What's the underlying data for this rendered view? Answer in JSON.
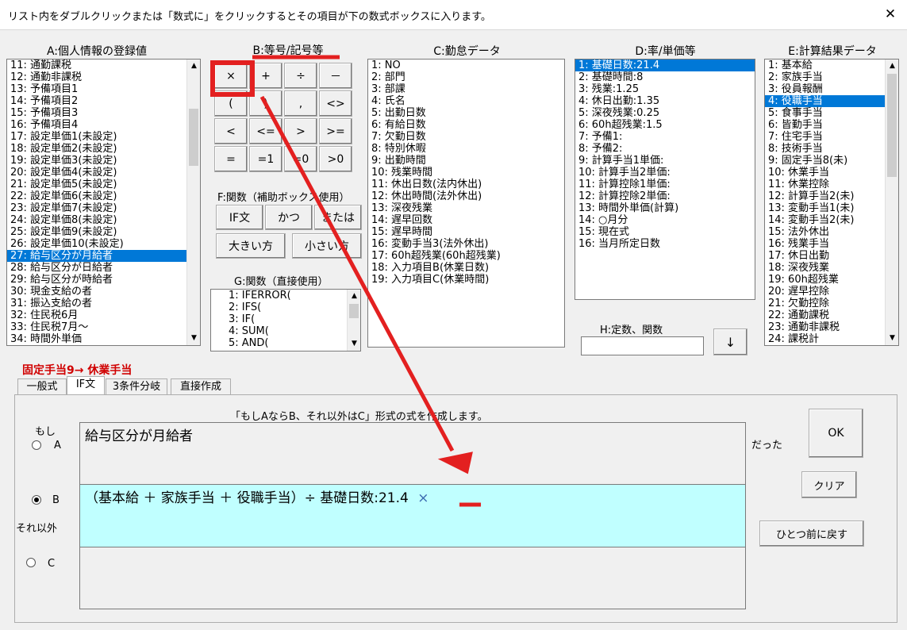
{
  "window": {
    "title": "リスト内をダブルクリックまたは「数式に」をクリックするとその項目が下の数式ボックスに入ります。",
    "close": "✕"
  },
  "headers": {
    "a": "A:個人情報の登録値",
    "b": "B:等号/記号等",
    "c": "C:勤怠データ",
    "d": "D:率/単価等",
    "e": "E:計算結果データ",
    "f": "F:関数（補助ボックス使用）",
    "g": "G:関数（直接使用）",
    "h": "H:定数、関数"
  },
  "list_a": [
    "11: 通勤課税",
    "12: 通勤非課税",
    "13: 予備項目1",
    "14: 予備項目2",
    "15: 予備項目3",
    "16: 予備項目4",
    "17: 設定単価1(未設定)",
    "18: 設定単価2(未設定)",
    "19: 設定単価3(未設定)",
    "20: 設定単価4(未設定)",
    "21: 設定単価5(未設定)",
    "22: 設定単価6(未設定)",
    "23: 設定単価7(未設定)",
    "24: 設定単価8(未設定)",
    "25: 設定単価9(未設定)",
    "26: 設定単価10(未設定)",
    "27: 給与区分が月給者",
    "28: 給与区分が日給者",
    "29: 給与区分が時給者",
    "30: 現金支給の者",
    "31: 振込支給の者",
    "32: 住民税6月",
    "33: 住民税7月～",
    "34: 時間外単価"
  ],
  "list_c": [
    "1: NO",
    "2: 部門",
    "3: 部課",
    "4: 氏名",
    "5: 出勤日数",
    "6: 有給日数",
    "7: 欠勤日数",
    "8: 特別休暇",
    "9: 出勤時間",
    "10: 残業時間",
    "11: 休出日数(法内休出)",
    "12: 休出時間(法外休出)",
    "13: 深夜残業",
    "14: 遅早回数",
    "15: 遅早時間",
    "16: 変動手当3(法外休出)",
    "17: 60h超残業(60h超残業)",
    "18: 入力項目B(休業日数)",
    "19: 入力項目C(休業時間)"
  ],
  "list_d": [
    "1: 基礎日数:21.4",
    "2: 基礎時間:8",
    "3: 残業:1.25",
    "4: 休日出勤:1.35",
    "5: 深夜残業:0.25",
    "6: 60h超残業:1.5",
    "7: 予備1:",
    "8: 予備2:",
    "9: 計算手当1単価:",
    "10: 計算手当2単価:",
    "11: 計算控除1単価:",
    "12: 計算控除2単価:",
    "13: 時間外単価(計算)",
    "14: ○月分",
    "15: 現在式",
    "16: 当月所定日数"
  ],
  "list_e": [
    "1: 基本給",
    "2: 家族手当",
    "3: 役員報酬",
    "4: 役職手当",
    "5: 食事手当",
    "6: 皆勤手当",
    "7: 住宅手当",
    "8: 技術手当",
    "9: 固定手当8(未)",
    "10: 休業手当",
    "11: 休業控除",
    "12: 計算手当2(未)",
    "13: 変動手当1(未)",
    "14: 変動手当2(未)",
    "15: 法外休出",
    "16: 残業手当",
    "17: 休日出勤",
    "18: 深夜残業",
    "19: 60h超残業",
    "20: 遅早控除",
    "21: 欠勤控除",
    "22: 通勤課税",
    "23: 通勤非課税",
    "24: 課税計"
  ],
  "list_g": [
    "1: IFERROR(",
    "2: IFS(",
    "3: IF(",
    "4: SUM(",
    "5: AND("
  ],
  "symbols": [
    "×",
    "+",
    "÷",
    "－",
    "(",
    ")",
    ",",
    "<>",
    "<",
    "<=",
    ">",
    ">=",
    "=",
    "=1",
    "=0",
    ">0"
  ],
  "func_buttons": {
    "if": "IF文",
    "and": "かつ",
    "or": "または",
    "max": "大きい方",
    "min": "小さい方"
  },
  "h_input": "",
  "down_button": "↓",
  "red_label": "固定手当9→ 休業手当",
  "tabs": [
    "一般式",
    "IF文",
    "3条件分岐",
    "直接作成"
  ],
  "if_panel": {
    "instruction": "「もしAならB、それ以外はC」形式の式を作成します。",
    "moshi": "もし",
    "a": "A",
    "b": "B",
    "c": "C",
    "else": "それ以外",
    "datta": "だった",
    "field_a": "給与区分が月給者",
    "field_b": "（基本給 ＋ 家族手当 ＋ 役職手当）÷ 基礎日数:21.4",
    "field_b_added": "×",
    "field_c": ""
  },
  "right_buttons": {
    "ok": "OK",
    "clear": "クリア",
    "undo": "ひとつ前に戻す"
  },
  "colors": {
    "selection": "#0078d7",
    "highlight_field": "#c0ffff",
    "annotation": "#e32020",
    "label_red": "#d00000"
  }
}
